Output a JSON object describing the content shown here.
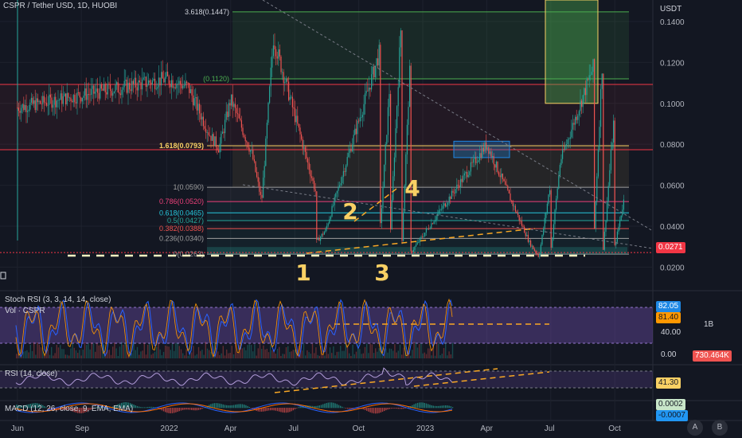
{
  "header": {
    "symbol_title": "CSPR / Tether USD, 1D, HUOBI",
    "currency": "USDT"
  },
  "colors": {
    "background": "#131722",
    "up": "#26a69a",
    "down": "#ef5350",
    "fib_gold": "#f9d064",
    "rsi_purple": "#7e57c2",
    "last_price_bg": "#f23645"
  },
  "chart_data": [
    {
      "type": "candlestick",
      "name": "price",
      "x_ticks": [
        "Jun",
        "Sep",
        "2022",
        "Apr",
        "Jul",
        "Oct",
        "2023",
        "Apr",
        "Jul",
        "Oct"
      ],
      "y_ticks": [
        "0.1400",
        "0.1200",
        "0.1000",
        "0.0800",
        "0.0600",
        "0.0400",
        "0.0200"
      ],
      "ylim": [
        0.0182,
        0.1505
      ],
      "last_price": "0.0271",
      "path_points": [
        [
          "Jun",
          0.098
        ],
        [
          "Jun",
          0.132
        ],
        [
          "Jul",
          0.062
        ],
        [
          "Jul",
          0.072
        ],
        [
          "Aug",
          0.056
        ],
        [
          "Sep",
          0.118
        ],
        [
          "Sep",
          0.128
        ],
        [
          "Oct",
          0.098
        ],
        [
          "Nov",
          0.126
        ],
        [
          "Nov",
          0.108
        ],
        [
          "Dec",
          0.142
        ],
        [
          "Dec",
          0.128
        ],
        [
          "2022",
          0.112
        ],
        [
          "Feb",
          0.108
        ],
        [
          "Mar",
          0.085
        ],
        [
          "Mar",
          0.078
        ],
        [
          "Apr",
          0.102
        ],
        [
          "Apr",
          0.08
        ],
        [
          "May",
          0.075
        ],
        [
          "May",
          0.052
        ],
        [
          "Jun",
          0.032
        ],
        [
          "Jun",
          0.025
        ],
        [
          "Jul",
          0.028
        ],
        [
          "Aug",
          0.032
        ],
        [
          "Aug",
          0.038
        ],
        [
          "Sep",
          0.029
        ],
        [
          "Sep",
          0.027
        ],
        [
          "Oct",
          0.03
        ],
        [
          "Oct",
          0.054
        ],
        [
          "Nov",
          0.038
        ],
        [
          "Nov",
          0.03
        ],
        [
          "Dec",
          0.027
        ],
        [
          "Dec",
          0.0271
        ]
      ],
      "fib_levels": [
        {
          "label": "3.618(0.1447)",
          "value": 0.1447
        },
        {
          "label": "(0.1120)",
          "value": 0.112
        },
        {
          "label": "1.618(0.0793)",
          "value": 0.0793
        },
        {
          "label": "1(0.0590)",
          "value": 0.059
        },
        {
          "label": "0.786(0.0520)",
          "value": 0.052
        },
        {
          "label": "0.618(0.0465)",
          "value": 0.0465
        },
        {
          "label": "0.5(0.0427)",
          "value": 0.0427
        },
        {
          "label": "0.382(0.0388)",
          "value": 0.0388
        },
        {
          "label": "0.236(0.0340)",
          "value": 0.034
        },
        {
          "label": "0(0.0263)",
          "value": 0.0263
        }
      ],
      "wave_labels": [
        "1",
        "2",
        "3",
        "4"
      ]
    },
    {
      "type": "line",
      "name": "stoch_rsi",
      "title": "Stoch RSI (3, 3, 14, 14, close)",
      "overlay_label": "Vol · CSPR",
      "value_k": "82.05",
      "value_d": "81.40",
      "y_ticks": [
        "40.00",
        "0.00"
      ],
      "volume_scale": "1B",
      "volume_value": "730.464K"
    },
    {
      "type": "line",
      "name": "rsi",
      "title": "RSI (14, close)",
      "value": "41.30"
    },
    {
      "type": "bar",
      "name": "macd",
      "title": "MACD (12, 26, close, 9, EMA, EMA)",
      "value_macd": "0.0002",
      "value_signal": "-0.0007"
    }
  ],
  "axis_buttons": {
    "auto": "A",
    "log": "B"
  }
}
